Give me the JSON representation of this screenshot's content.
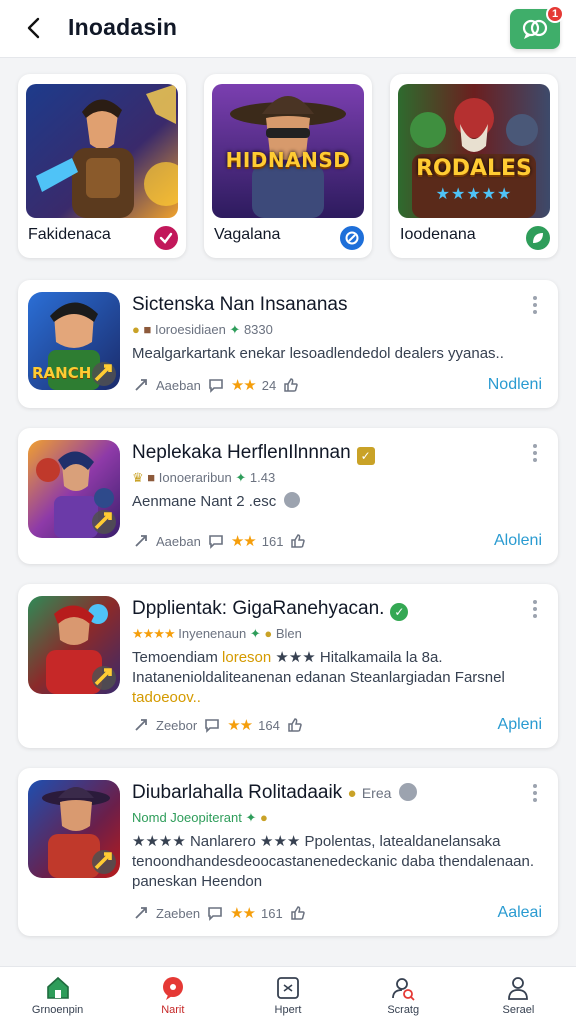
{
  "header": {
    "title": "Inoadasin",
    "notification_count": "1"
  },
  "featured": [
    {
      "label": "Fakidenaca",
      "badge_color": "#c2185b"
    },
    {
      "label": "Vagalana",
      "logo_text": "HIDNANSD",
      "badge_color": "#1e6fd9"
    },
    {
      "label": "Ioodenana",
      "logo_text": "RODALES",
      "badge_color": "#2e9d5a"
    }
  ],
  "apps": [
    {
      "title": "Sictenska Nan Insananas",
      "meta_pre": "Ioroesidiaen",
      "meta_post": "8330",
      "description": "Mealgarkartank enekar lesoadlendedol dealers yyanas..",
      "stat1": "Aaeban",
      "stat2": "24",
      "action": "Nodleni",
      "icon_text": "RANCH"
    },
    {
      "title": "Neplekaka HerflenIlnnnan",
      "verified": "✓",
      "meta_pre": "Ionoeraribun",
      "meta_post": "1.43",
      "description": "Aenmane Nant 2 .esc",
      "stat1": "Aaeban",
      "stat2": "161",
      "action": "Aloleni"
    },
    {
      "title": "Dpplientak: GigaRanehyacan.",
      "verified": "✓",
      "meta_pre": "Inyenenaun",
      "meta_post": "Blen",
      "desc_a": "Temoendiam ",
      "desc_hl": "loreson",
      "desc_b": " ★★★ Hitalkamaila la 8a. Inatanenioldaliteanenan edanan Steanlargiadan Farsnel ",
      "desc_c": "tadoeoov..",
      "stat1": "Zeebor",
      "stat2": "164",
      "action": "Apleni"
    },
    {
      "title": "Diubarlahalla Rolitadaaik",
      "tag": "Erea",
      "meta_pre": "Nomd Joeopiterant",
      "description": "★★★★ Nanlarero ★★★ Ppolentas, latealdanelansaka tenoondhandesdeoocastanenedeckanic daba thendalenaan. paneskan Heendon",
      "stat1": "Zaeben",
      "stat2": "161",
      "action": "Aaleai"
    }
  ],
  "nav": [
    {
      "label": "Grnoenpin"
    },
    {
      "label": "Narit"
    },
    {
      "label": "Hpert"
    },
    {
      "label": "Scratg"
    },
    {
      "label": "Serael"
    }
  ],
  "colors": {
    "accent_green": "#3fae6a",
    "link_blue": "#2a9bd1",
    "star": "#f59e0b",
    "active_nav": "#c62828"
  }
}
